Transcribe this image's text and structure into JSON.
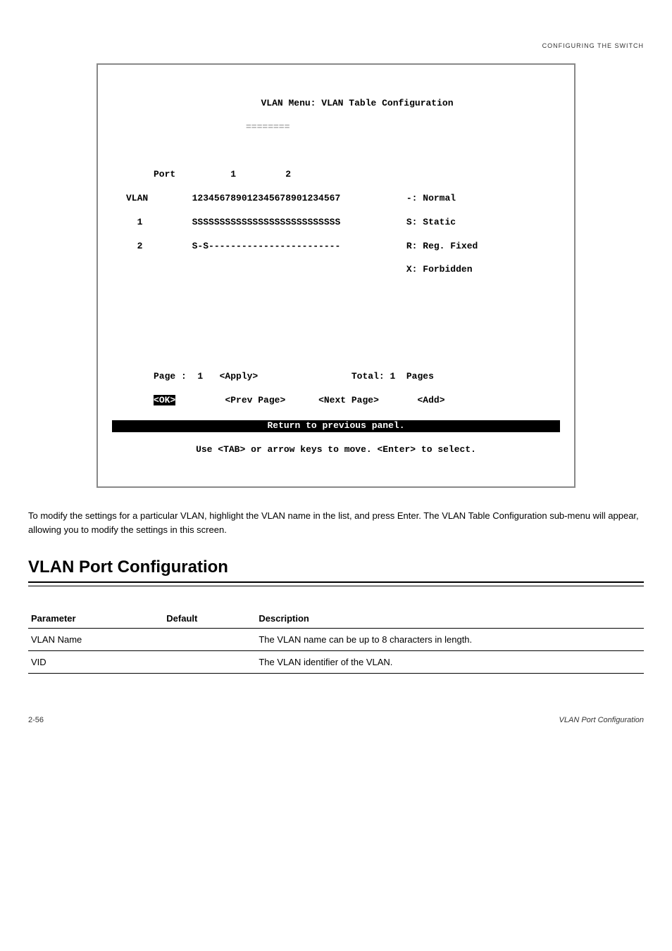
{
  "page_header_label": "CONFIGURING THE SWITCH",
  "terminal": {
    "title": "VLAN Menu: VLAN Table Configuration",
    "dash": "========",
    "port_header": "     Port          1         2",
    "vlan_line": "VLAN        123456789012345678901234567",
    "row1": "  1         SSSSSSSSSSSSSSSSSSSSSSSSSSS",
    "row2": "  2         S-S------------------------",
    "legend1": "-: Normal",
    "legend2": "S: Static",
    "legend3": "R: Reg. Fixed",
    "legend4": "X: Forbidden",
    "nav_line1_left": "     Page :  1   <Apply>",
    "nav_line1_right": "Total: 1  Pages",
    "nav_line2_ok": "<OK>",
    "nav_line2_rest": "         <Prev Page>      <Next Page>       <Add>",
    "status_line": "Return to previous panel.",
    "help_line": "Use <TAB> or arrow keys to move. <Enter> to select."
  },
  "body_para": "To modify the settings for a particular VLAN, highlight the VLAN name in the list, and press Enter. The VLAN Table Configuration sub-menu will appear, allowing you to modify the settings in this screen.",
  "section_heading": "VLAN Port Configuration",
  "table": {
    "headers": {
      "param": "Parameter",
      "default": "Default",
      "desc": "Description"
    },
    "rows": [
      {
        "param": "VLAN Name",
        "default": "",
        "desc": "The VLAN name can be up to 8 characters in length."
      },
      {
        "param": "VID",
        "default": "",
        "desc": "The VLAN identifier of the VLAN."
      }
    ]
  },
  "footer": {
    "left": "2-56",
    "right": "VLAN Port Configuration"
  }
}
